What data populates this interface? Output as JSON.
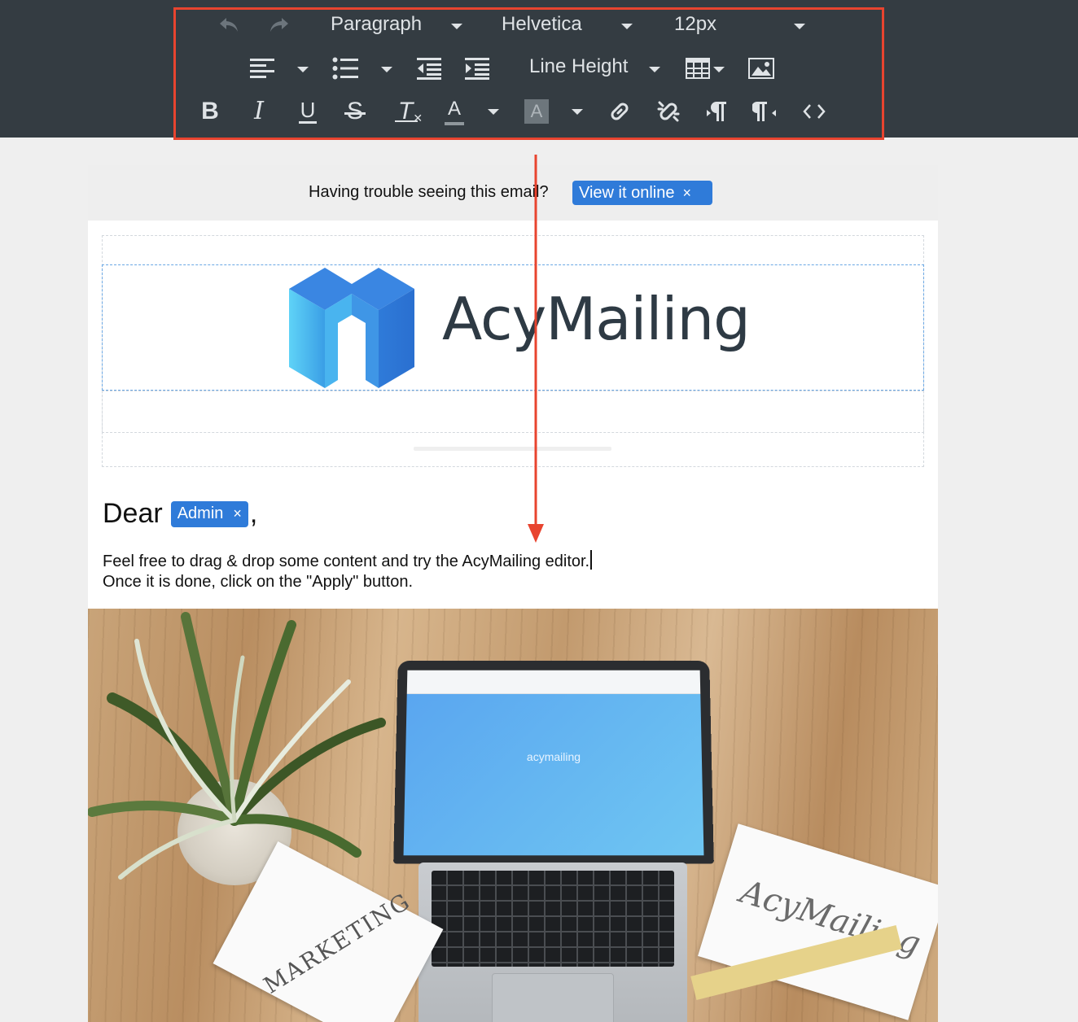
{
  "toolbar": {
    "block_format": "Paragraph",
    "font_family": "Helvetica",
    "font_size": "12px",
    "line_height": "Line Height",
    "highlight_color": "#e8442f"
  },
  "email": {
    "trouble_text": "Having trouble seeing this email?",
    "view_online_label": "View it online",
    "tag_remove": "×",
    "logo_text_acy": "Acy",
    "logo_text_mailing": "Mailing",
    "greeting": "Dear",
    "user_tag": "Admin",
    "greeting_punct": ",",
    "body_line_1": "Feel free to drag & drop some content and try the AcyMailing editor.",
    "body_line_2": "Once it is done, click on the \"Apply\" button.",
    "brand_color": "#2f7bd9"
  },
  "photo": {
    "card_left_text": "MARKETING",
    "card_right_text": "AcyMailing",
    "laptop_brand": "acymailing"
  }
}
